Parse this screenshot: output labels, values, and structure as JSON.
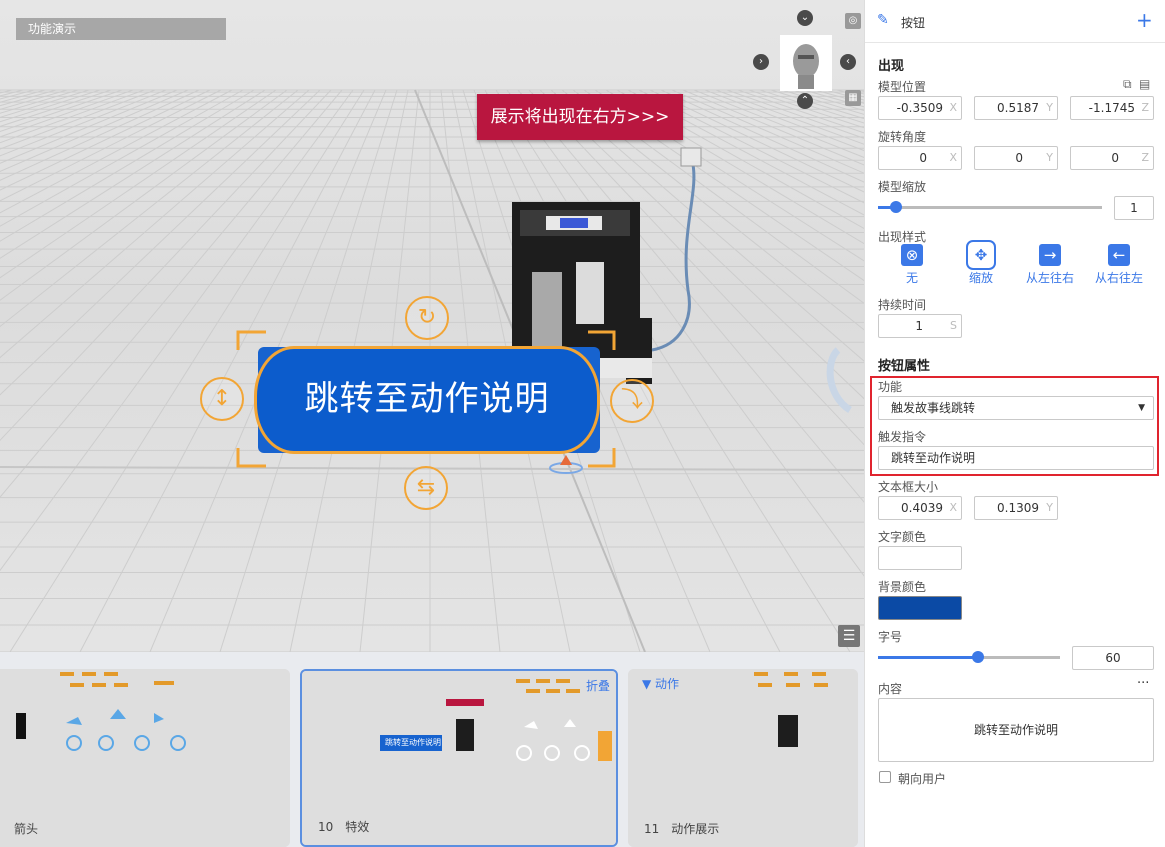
{
  "viewport": {
    "title": "功能演示",
    "banner_text": "展示将出现在右方>>>",
    "button_text": "跳转至动作说明",
    "icons": [
      "chevron-down-icon",
      "target-icon",
      "chevron-right-icon",
      "chevron-left-icon",
      "chevron-up-icon",
      "keyboard-icon",
      "list-icon",
      "rotate-icon",
      "resize-vertical-icon",
      "flip-icon",
      "move-horizontal-icon"
    ]
  },
  "timeline": {
    "items": [
      {
        "label": "箭头"
      },
      {
        "label": "10　特效",
        "fold": "折叠",
        "mini_button": "跳转至动作说明"
      },
      {
        "label": "11　动作展示",
        "action": "动作"
      }
    ]
  },
  "panel": {
    "header_title": "按钮",
    "appear": {
      "title": "出现",
      "position_label": "模型位置",
      "position": {
        "x": "-0.3509",
        "y": "0.5187",
        "z": "-1.1745"
      },
      "rotation_label": "旋转角度",
      "rotation": {
        "x": "0",
        "y": "0",
        "z": "0"
      },
      "scale_label": "模型缩放",
      "scale_value": "1",
      "scale_slider": 0.08,
      "style_label": "出现样式",
      "styles": [
        "无",
        "缩放",
        "从左往右",
        "从右往左"
      ],
      "selected_style": "缩放",
      "duration_label": "持续时间",
      "duration": "1",
      "duration_unit": "S"
    },
    "props": {
      "title": "按钮属性",
      "function_label": "功能",
      "function_value": "触发故事线跳转",
      "trigger_label": "触发指令",
      "trigger_value": "跳转至动作说明",
      "textbox_label": "文本框大小",
      "textbox": {
        "x": "0.4039",
        "y": "0.1309"
      },
      "text_color_label": "文字颜色",
      "text_color": "#ffffff",
      "bg_color_label": "背景颜色",
      "bg_color": "#0b4aa5",
      "font_size_label": "字号",
      "font_size": "60",
      "font_slider": 0.55,
      "content_label": "内容",
      "content_menu": "···",
      "content_value": "跳转至动作说明",
      "face_user_label": "朝向用户",
      "face_user_checked": false
    },
    "axis": {
      "x": "X",
      "y": "Y",
      "z": "Z"
    }
  },
  "colors": {
    "accent": "#3b78e7",
    "handle": "#f2a535",
    "banner": "#b9163f",
    "highlight": "#e0242e"
  }
}
